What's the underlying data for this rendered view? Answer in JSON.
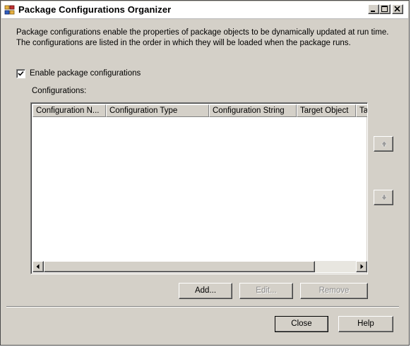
{
  "window": {
    "title": "Package Configurations Organizer",
    "controls": {
      "minimize": "minimize-icon",
      "maximize": "maximize-icon",
      "close": "close-icon"
    }
  },
  "description": {
    "line1": "Package configurations enable the properties of package objects to be dynamically updated at run time.",
    "line2": "The configurations are listed in the order in which they will be loaded when the package runs."
  },
  "enable_checkbox": {
    "label": "Enable package configurations",
    "checked": true
  },
  "configurations": {
    "label": "Configurations:",
    "columns": [
      "Configuration N...",
      "Configuration Type",
      "Configuration String",
      "Target Object",
      "Ta"
    ],
    "rows": []
  },
  "buttons": {
    "move_up": "arrow-up-icon",
    "move_down": "arrow-down-icon",
    "add": "Add...",
    "edit": "Edit...",
    "remove": "Remove",
    "close": "Close",
    "help": "Help"
  }
}
